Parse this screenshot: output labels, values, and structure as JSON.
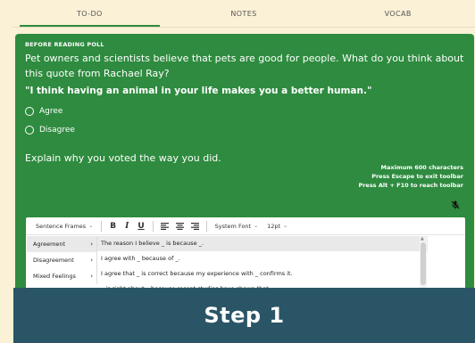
{
  "tabs": [
    {
      "label": "TO-DO",
      "active": true
    },
    {
      "label": "NOTES",
      "active": false
    },
    {
      "label": "VOCAB",
      "active": false
    }
  ],
  "poll": {
    "label": "BEFORE READING POLL",
    "question": "Pet owners and scientists believe that pets are good for people. What do you think about this quote from Rachael Ray?",
    "quote": "\"I think having an animal in your life makes you a better human.\"",
    "options": [
      "Agree",
      "Disagree"
    ]
  },
  "explain": {
    "prompt": "Explain why you voted the way you did.",
    "hints": [
      "Maximum 600 characters",
      "Press Escape to exit toolbar",
      "Press Alt + F10 to reach toolbar"
    ]
  },
  "toolbar": {
    "sentence_frames": "Sentence Frames",
    "bold": "B",
    "italic": "I",
    "underline": "U",
    "font": "System Font",
    "size": "12pt"
  },
  "menu": {
    "categories": [
      "Agreement",
      "Disagreement",
      "Mixed Feelings"
    ],
    "frames": [
      "The reason I believe _ is because _.",
      "I agree with _ because of _.",
      "I agree that _ is correct because my experience with _ confirms it.",
      "_ is right about _ because recent studies have shown that _."
    ]
  },
  "step": {
    "label": "Step 1"
  },
  "colors": {
    "panel": "#2e8b3f",
    "background": "#fbf1d6",
    "step_banner": "#2a5566"
  }
}
